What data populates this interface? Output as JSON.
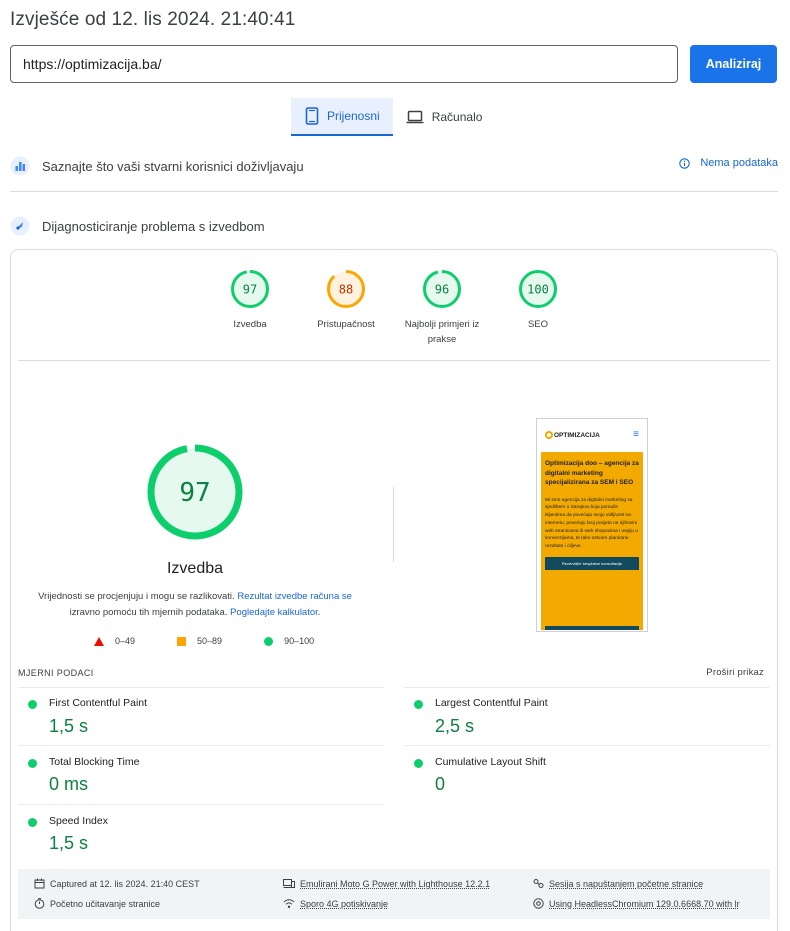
{
  "report": {
    "title": "Izvješće od 12. lis 2024. 21:40:41"
  },
  "search": {
    "url": "https://optimizacija.ba/",
    "analyze_label": "Analiziraj"
  },
  "device_tabs": [
    {
      "label": "Prijenosni",
      "icon": "smartphone-icon",
      "active": true
    },
    {
      "label": "Računalo",
      "icon": "laptop-icon",
      "active": false
    }
  ],
  "field_section": {
    "title": "Saznajte što vaši stvarni korisnici doživljavaju",
    "no_data_label": "Nema podataka"
  },
  "diagnostics_section": {
    "title": "Dijagnosticiranje problema s izvedbom"
  },
  "category_scores": [
    {
      "score": "97",
      "label": "Izvedba",
      "status": "pass",
      "color": "#0cce6b"
    },
    {
      "score": "88",
      "label": "Pristupačnost",
      "status": "average",
      "color": "#ffa400"
    },
    {
      "score": "96",
      "label": "Najbolji primjeri iz prakse",
      "status": "pass",
      "color": "#0cce6b"
    },
    {
      "score": "100",
      "label": "SEO",
      "status": "pass",
      "color": "#0cce6b"
    }
  ],
  "performance": {
    "score": "97",
    "title": "Izvedba",
    "desc_before": "Vrijednosti se procjenjuju i mogu se razlikovati. ",
    "desc_link1": "Rezultat izvedbe računa se",
    "desc_middle": " izravno pomoću tih mjernih podataka. ",
    "desc_link2": "Pogledajte kalkulator",
    "desc_after": "."
  },
  "legend": [
    {
      "range": "0–49",
      "shape": "triangle",
      "color": "#eb0f00"
    },
    {
      "range": "50–89",
      "shape": "square",
      "color": "#ffa400"
    },
    {
      "range": "90–100",
      "shape": "circle",
      "color": "#0cce6b"
    }
  ],
  "page_screenshot": {
    "logo": "OPTIMIZACIJA",
    "heading": "Optimizacija doo – agencija za digitalni marketing specijalizirana za SEM i SEO",
    "text": "Mi smo agencija za digitalni marketing sa sjedištem u Sarajevu koja pomaže klijentima da povećaju svoju vidljivost na internetu, povećaju broj posjeta na njihovim web stranicama ili web shopovima i uspiju u konverzijama, te tako ostvare planirane rezultate i ciljeve.",
    "button": "Rezervišite besplatne konsultacije",
    "accent_color": "#f2a900"
  },
  "metrics_section": {
    "label": "MJERNI PODACI",
    "expand_label": "Proširi prikaz"
  },
  "metrics": [
    {
      "name": "First Contentful Paint",
      "value": "1,5 s"
    },
    {
      "name": "Largest Contentful Paint",
      "value": "2,5 s"
    },
    {
      "name": "Total Blocking Time",
      "value": "0 ms"
    },
    {
      "name": "Cumulative Layout Shift",
      "value": "0"
    },
    {
      "name": "Speed Index",
      "value": "1,5 s"
    }
  ],
  "footer": {
    "captured": "Captured at 12. lis 2024. 21:40 CEST",
    "device": "Emulirani Moto G Power with Lighthouse 12.2.1",
    "session": "Sesija s napuštanjem početne stranice",
    "initial_load": "Početno učitavanje stranice",
    "throttling": "Sporo 4G potiskivanje",
    "browser": "Using HeadlessChromium 129.0.6668.70 with lr"
  }
}
